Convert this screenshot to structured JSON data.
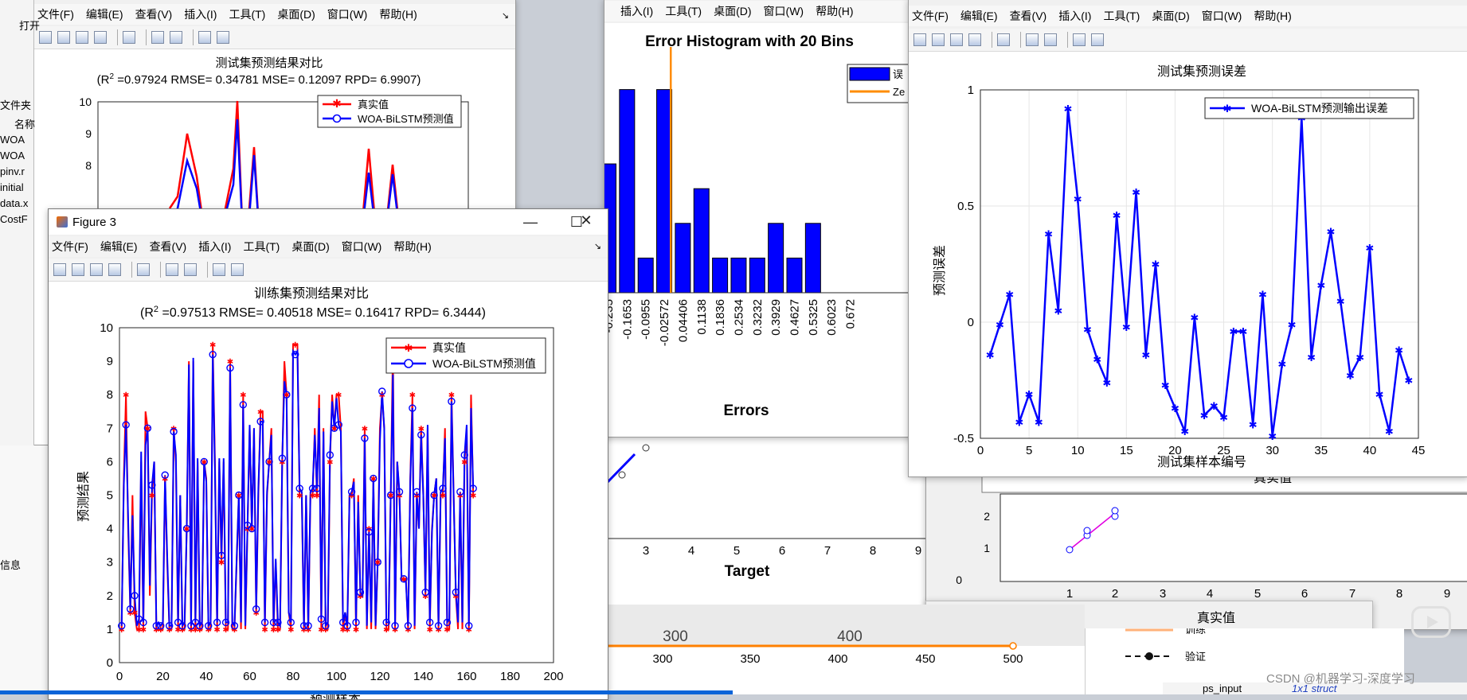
{
  "menus": [
    "文件(F)",
    "编辑(E)",
    "查看(V)",
    "插入(I)",
    "工具(T)",
    "桌面(D)",
    "窗口(W)",
    "帮助(H)"
  ],
  "menus_partial": [
    "插入(I)",
    "工具(T)",
    "桌面(D)",
    "窗口(W)",
    "帮助(H)"
  ],
  "figure3": {
    "title": "Figure 3",
    "minimize": "—",
    "maximize": "☐",
    "close": "✕"
  },
  "left_panel": {
    "top_label": "打开",
    "folder_label": "文件夹",
    "name_header": "名称",
    "files": [
      "WOA",
      "WOA",
      "pinv.r",
      "initial",
      "data.x",
      "CostF"
    ],
    "info_label": "信息"
  },
  "test_compare": {
    "title": "测试集预测结果对比",
    "subtitle_prefix": "(R",
    "subtitle_sup": "2",
    "subtitle_rest": " =0.97924 RMSE= 0.34781 MSE= 0.12097 RPD= 6.9907)",
    "legend": [
      "真实值",
      "WOA-BiLSTM预测值"
    ],
    "yticks": [
      "10",
      "9",
      "8"
    ]
  },
  "histogram": {
    "title": "Error Histogram with 20 Bins",
    "xlabel": "Errors",
    "legend_partial": [
      "误",
      "Ze"
    ],
    "color": "#0000ff",
    "zero_color": "#ff8c00"
  },
  "test_error": {
    "title": "测试集预测误差",
    "ylabel": "预测误差",
    "xlabel": "测试集样本编号",
    "legend": "WOA-BiLSTM预测输出误差"
  },
  "training": {
    "title": "训练集预测结果对比",
    "subtitle_prefix": "(R",
    "subtitle_sup": "2",
    "subtitle_rest": " =0.97513 RMSE= 0.40518 MSE= 0.16417 RPD= 6.3444)",
    "legend": [
      "真实值",
      "WOA-BiLSTM预测值"
    ],
    "ylabel": "预测结果",
    "xlabel_partial": "预测样本"
  },
  "regression": {
    "target_label": "Target",
    "target_ticks": [
      "3",
      "4",
      "5",
      "6",
      "7",
      "8",
      "9"
    ],
    "true_label": "真实值",
    "ticks": [
      "1",
      "2",
      "3",
      "4",
      "5",
      "6",
      "7",
      "8",
      "9"
    ],
    "yticks": [
      "2",
      "1",
      "0"
    ]
  },
  "perf": {
    "ticks_top": [
      "300",
      "400"
    ],
    "ticks_bottom": [
      "300",
      "350",
      "400",
      "450",
      "500"
    ],
    "legend": [
      "训练",
      "验证"
    ]
  },
  "workspace": {
    "var_name": "ps_input",
    "var_value": "1x1 struct"
  },
  "watermark": "CSDN @机器学习-深度学习",
  "colors": {
    "red": "#ff0000",
    "blue": "#0000ff",
    "accent": "#0a64d8"
  },
  "chart_data": [
    {
      "type": "bar",
      "title": "Error Histogram with 20 Bins",
      "xlabel": "Errors",
      "categories": [
        "-0.2350",
        "-0.1653",
        "-0.0955",
        "-0.02572",
        "0.04406",
        "0.1138",
        "0.1836",
        "0.2534",
        "0.3232",
        "0.3929",
        "0.4627",
        "0.5325",
        "0.6023",
        "0.672"
      ],
      "category_labels": [
        "-0.235",
        "-0.1653",
        "-0.0955",
        "-0.02572",
        "0.04406",
        "0.1138",
        "0.1836",
        "0.2534",
        "0.3232",
        "0.3929",
        "0.4627",
        "0.5325",
        "0.6023",
        "0.672"
      ],
      "values": [
        26,
        41,
        7,
        41,
        14,
        21,
        7,
        7,
        7,
        14,
        7,
        14,
        0,
        0
      ],
      "ylim": [
        0,
        48
      ]
    },
    {
      "type": "line",
      "title": "测试集预测误差",
      "xlabel": "测试集样本编号",
      "ylabel": "预测误差",
      "xlim": [
        0,
        45
      ],
      "ylim": [
        -0.5,
        1
      ],
      "xticks": [
        0,
        5,
        10,
        15,
        20,
        25,
        30,
        35,
        40,
        45
      ],
      "yticks": [
        -0.5,
        0,
        0.5,
        1
      ],
      "grid": true,
      "legend": "top-right",
      "series": [
        {
          "name": "WOA-BiLSTM预测输出误差",
          "x": [
            1,
            2,
            3,
            4,
            5,
            6,
            7,
            8,
            9,
            10,
            11,
            12,
            13,
            14,
            15,
            16,
            17,
            18,
            19,
            20,
            21,
            22,
            23,
            24,
            25,
            26,
            27,
            28,
            29,
            30,
            31,
            32,
            33,
            34,
            35,
            36,
            37,
            38,
            39,
            40,
            41,
            42,
            43,
            44
          ],
          "y": [
            -0.14,
            -0.01,
            0.12,
            -0.43,
            -0.31,
            -0.43,
            0.38,
            0.05,
            0.92,
            0.53,
            -0.03,
            -0.16,
            -0.26,
            0.46,
            -0.02,
            0.56,
            -0.14,
            0.25,
            -0.27,
            -0.37,
            -0.47,
            0.02,
            -0.4,
            -0.36,
            -0.41,
            -0.04,
            -0.04,
            -0.44,
            0.12,
            -0.49,
            -0.18,
            -0.01,
            0.88,
            -0.15,
            0.16,
            0.39,
            0.09,
            -0.23,
            -0.15,
            0.32,
            -0.31,
            -0.47,
            -0.12,
            -0.25
          ]
        }
      ]
    },
    {
      "type": "line",
      "title": "训练集预测结果对比",
      "ylabel": "预测结果",
      "xlim": [
        0,
        200
      ],
      "ylim": [
        0,
        10
      ],
      "xticks": [
        0,
        20,
        40,
        60,
        80,
        100,
        120,
        140,
        160,
        180,
        200
      ],
      "yticks": [
        0,
        1,
        2,
        3,
        4,
        5,
        6,
        7,
        8,
        9,
        10
      ],
      "legend": "top-right",
      "series": [
        {
          "name": "真实值",
          "y": [
            1,
            5.5,
            8,
            4,
            1.5,
            5,
            1.5,
            1,
            1,
            6,
            1,
            7.5,
            7,
            2,
            5,
            6,
            1,
            1,
            1,
            1,
            5.5,
            3,
            1,
            1,
            7,
            6,
            1,
            5,
            1,
            1,
            4,
            9,
            1,
            9,
            1,
            6,
            1,
            1,
            6,
            5.5,
            1,
            1,
            9.5,
            6,
            1,
            6,
            3,
            6,
            1,
            1,
            9,
            1,
            1,
            3,
            5,
            1,
            8,
            1,
            4,
            7,
            4,
            7,
            1.5,
            5,
            7.5,
            7.5,
            1,
            5,
            6,
            7,
            1,
            3,
            1,
            1,
            6,
            9,
            8,
            1.5,
            1,
            9.5,
            9.5,
            9.5,
            5,
            5,
            1,
            5,
            1,
            5,
            5,
            7,
            5,
            8,
            1,
            7,
            1,
            1,
            6,
            8,
            7,
            8,
            8,
            7,
            1,
            1.5,
            1,
            5,
            5,
            5.5,
            1,
            5,
            2,
            2,
            7,
            1,
            4,
            1,
            5.5,
            1,
            3,
            7,
            8,
            7,
            1,
            1,
            5,
            9.5,
            1,
            6,
            5,
            2.5,
            2.5,
            2.5,
            1,
            5.5,
            8,
            1,
            5,
            4,
            7,
            5,
            2,
            7,
            1,
            4,
            5,
            5.5,
            1,
            5,
            5,
            7,
            1,
            1,
            8,
            5,
            2,
            1,
            5,
            1,
            6,
            7,
            1,
            8,
            5
          ]
        },
        {
          "name": "WOA-BiLSTM预测值",
          "y": [
            1.1,
            5.3,
            7.1,
            4.3,
            1.6,
            4.4,
            2,
            1.1,
            1.3,
            6.3,
            1.2,
            6.5,
            7,
            2.3,
            5.3,
            6,
            1.1,
            1.2,
            1.1,
            1.2,
            5.6,
            3.2,
            1.1,
            1.1,
            6.9,
            6.2,
            1.2,
            5,
            1.1,
            1.2,
            4,
            8.9,
            1.1,
            9.1,
            1.2,
            6.1,
            1.1,
            1.2,
            6,
            5.4,
            1.1,
            1.2,
            9.2,
            5.7,
            1.2,
            6.1,
            3.2,
            6.1,
            1.2,
            1.2,
            8.8,
            1.2,
            1.1,
            3.1,
            5,
            1.2,
            7.7,
            1.1,
            4.1,
            7.1,
            4,
            7,
            1.6,
            5.2,
            7.2,
            7.2,
            1.2,
            5.1,
            6,
            6.8,
            1.2,
            3.1,
            1.2,
            1.1,
            6.1,
            8.4,
            8,
            1.5,
            1.2,
            9.3,
            9.2,
            9.3,
            5.2,
            5.1,
            1.1,
            5,
            1.1,
            5.1,
            5.2,
            6.8,
            5.2,
            7.6,
            1.3,
            6.9,
            1.1,
            1.2,
            6.2,
            7.8,
            7,
            7.9,
            7.1,
            6.9,
            1.2,
            1.5,
            1.1,
            5,
            5.1,
            5.4,
            1.2,
            4.8,
            2.1,
            2,
            6.7,
            1.1,
            3.9,
            1.2,
            5.5,
            1.1,
            3,
            6.6,
            8.1,
            7,
            1.2,
            1.2,
            5,
            8.6,
            1.1,
            6,
            5.1,
            2.5,
            2.5,
            2.4,
            1.1,
            5.4,
            7.6,
            1.1,
            5.1,
            4,
            6.8,
            5,
            2.1,
            7.1,
            1.2,
            3.9,
            5,
            5.5,
            1.1,
            5.1,
            5.2,
            6.7,
            1.2,
            1.3,
            7.8,
            4.9,
            2.1,
            1.2,
            5.1,
            1.2,
            6.2,
            7.1,
            1.1,
            7.6,
            5.2
          ]
        }
      ]
    }
  ]
}
